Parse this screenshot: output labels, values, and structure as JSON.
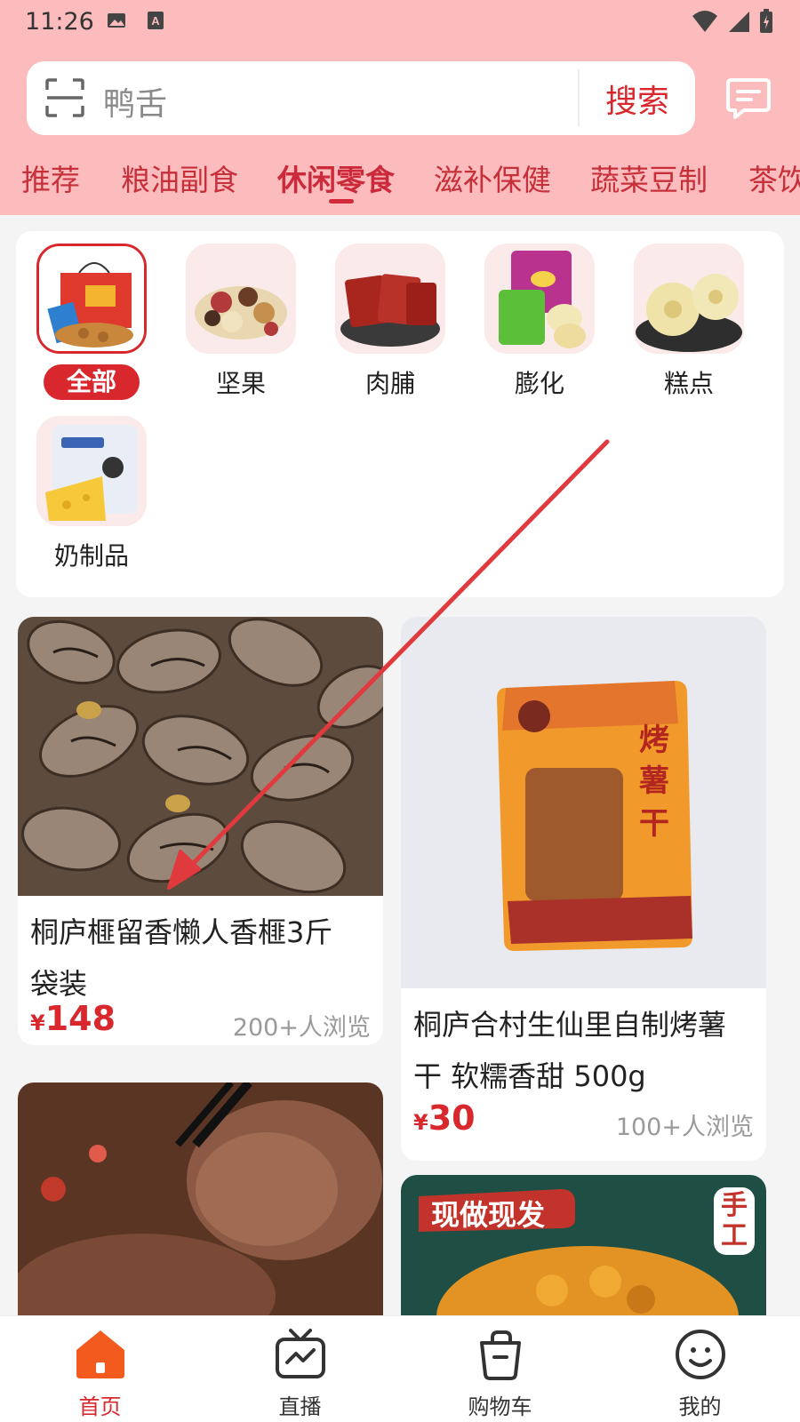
{
  "status_bar": {
    "time": "11:26"
  },
  "search": {
    "query": "鸭舌",
    "button_label": "搜索"
  },
  "tabs": [
    {
      "label": "推荐"
    },
    {
      "label": "粮油副食"
    },
    {
      "label": "休闲零食",
      "active": true
    },
    {
      "label": "滋补保健"
    },
    {
      "label": "蔬菜豆制"
    },
    {
      "label": "茶饮"
    }
  ],
  "categories": [
    {
      "label": "全部",
      "selected": true
    },
    {
      "label": "坚果"
    },
    {
      "label": "肉脯"
    },
    {
      "label": "膨化"
    },
    {
      "label": "糕点"
    },
    {
      "label": "奶制品"
    }
  ],
  "products": [
    {
      "title_line1": "桐庐榧留香懒人香榧3斤",
      "title_line2": "袋装",
      "currency": "¥",
      "price": "148",
      "views": "200+人浏览"
    },
    {
      "title_line1": "桐庐合村生仙里自制烤薯",
      "title_line2": "干 软糯香甜 500g",
      "currency": "¥",
      "price": "30",
      "views": "100+人浏览"
    }
  ],
  "product_images": {
    "sweet_potato_pack_text": "烤薯干",
    "handmade_banner": "现做现发",
    "handmade_badge": "手工"
  },
  "bottom_nav": [
    {
      "label": "首页",
      "icon": "home-icon",
      "active": true
    },
    {
      "label": "直播",
      "icon": "tv-icon"
    },
    {
      "label": "购物车",
      "icon": "cart-icon"
    },
    {
      "label": "我的",
      "icon": "smiley-icon"
    }
  ],
  "colors": {
    "accent": "#d8282e",
    "header_bg": "#fcbcbd"
  }
}
